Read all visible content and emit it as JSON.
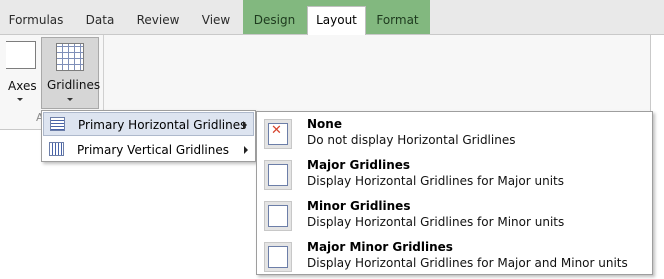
{
  "tabs": [
    {
      "label": "Formulas"
    },
    {
      "label": "Data"
    },
    {
      "label": "Review"
    },
    {
      "label": "View"
    },
    {
      "label": "Design"
    },
    {
      "label": "Layout"
    },
    {
      "label": "Format"
    }
  ],
  "active_tab": "Layout",
  "contextual_tab_color": "#82b87f",
  "ribbon": {
    "axes_label": "Axes",
    "gridlines_label": "Gridlines",
    "group_label_partial": "A"
  },
  "gridlines_menu": {
    "items": [
      {
        "label": "Primary Horizontal Gridlines",
        "icon": "horizontal-gridlines-icon",
        "highlighted": true
      },
      {
        "label": "Primary Vertical Gridlines",
        "icon": "vertical-gridlines-icon",
        "highlighted": false
      }
    ]
  },
  "horizontal_submenu": {
    "items": [
      {
        "title": "None",
        "description": "Do not display Horizontal Gridlines",
        "icon": "no-gridlines-icon"
      },
      {
        "title": "Major Gridlines",
        "description": "Display Horizontal Gridlines for Major units",
        "icon": "major-gridlines-icon"
      },
      {
        "title": "Minor Gridlines",
        "description": "Display Horizontal Gridlines for Minor units",
        "icon": "minor-gridlines-icon"
      },
      {
        "title": "Major Minor Gridlines",
        "description": "Display Horizontal Gridlines for Major and Minor units",
        "icon": "major-minor-gridlines-icon"
      }
    ]
  }
}
